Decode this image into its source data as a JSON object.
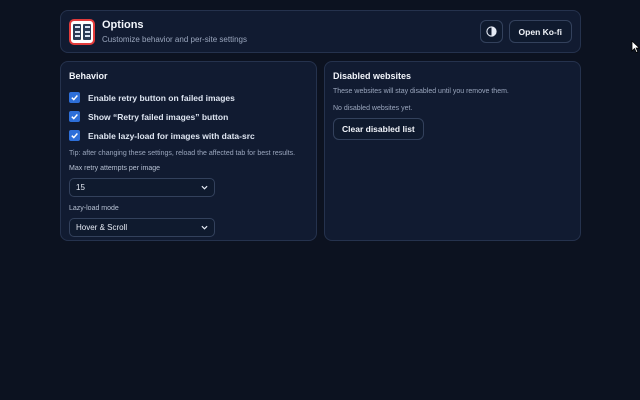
{
  "header": {
    "title": "Options",
    "subtitle": "Customize behavior and per-site settings",
    "theme_icon": "contrast-icon",
    "kofi_label": "Open Ko-fi"
  },
  "behavior": {
    "title": "Behavior",
    "options": [
      {
        "label": "Enable retry button on failed images",
        "checked": true
      },
      {
        "label": "Show “Retry failed images” button",
        "checked": true
      },
      {
        "label": "Enable lazy-load for images with data-src",
        "checked": true
      }
    ],
    "tip": "Tip: after changing these settings, reload the affected tab for best results.",
    "retry_label": "Max retry attempts per image",
    "retry_value": "15",
    "lazy_label": "Lazy-load mode",
    "lazy_value": "Hover & Scroll"
  },
  "disabled": {
    "title": "Disabled websites",
    "description": "These websites will stay disabled until you remove them.",
    "empty_text": "No disabled websites yet.",
    "clear_label": "Clear disabled list"
  },
  "colors": {
    "background": "#0c1220",
    "card": "#111b31",
    "accent": "#2d6fd9"
  }
}
